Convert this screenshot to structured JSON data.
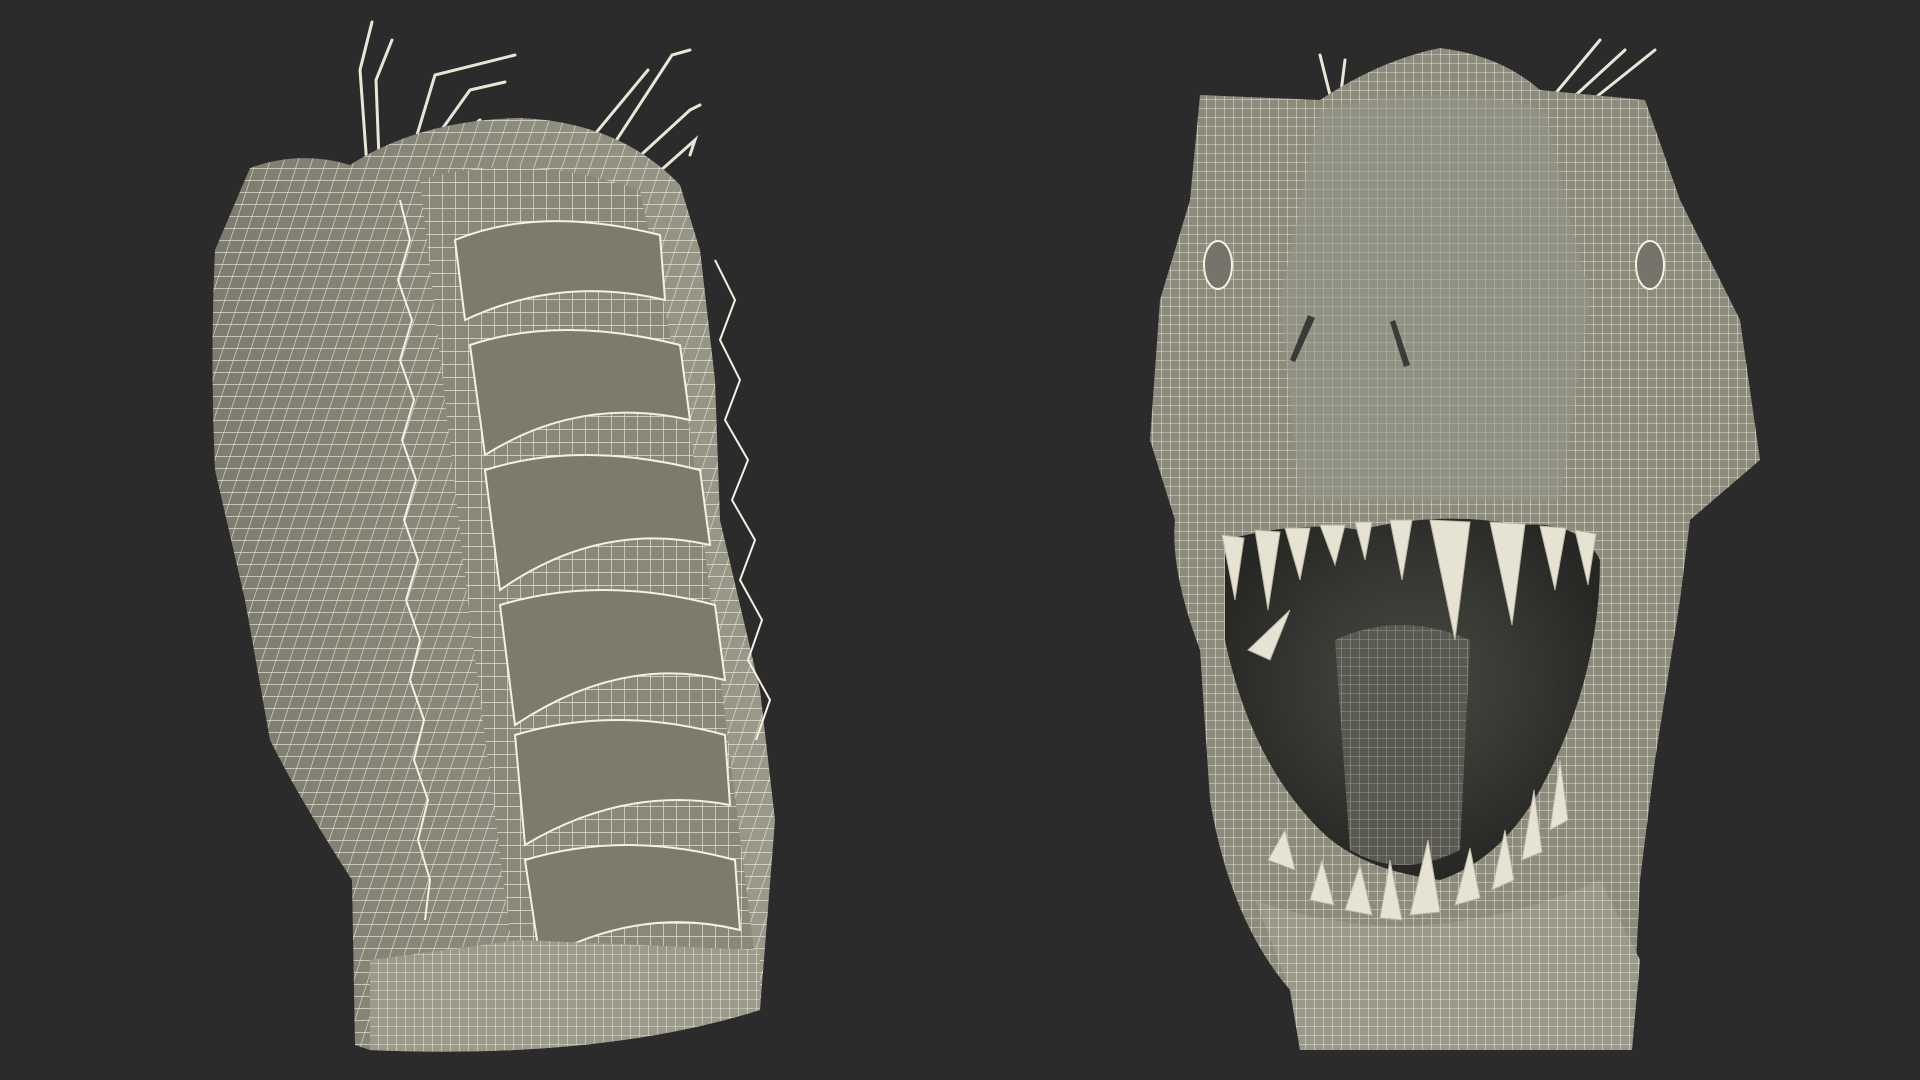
{
  "scene": {
    "background_color": "#2b2b2b",
    "mesh_fill_color": "#8d8c7c",
    "mesh_shade_color": "#6f6e61",
    "wire_color": "#f4f1e2",
    "mouth_dark_color": "#3c3c37",
    "views": [
      {
        "name": "rear-view",
        "subject": "dinosaur-head-wireframe"
      },
      {
        "name": "front-view",
        "subject": "dinosaur-head-wireframe"
      }
    ]
  }
}
